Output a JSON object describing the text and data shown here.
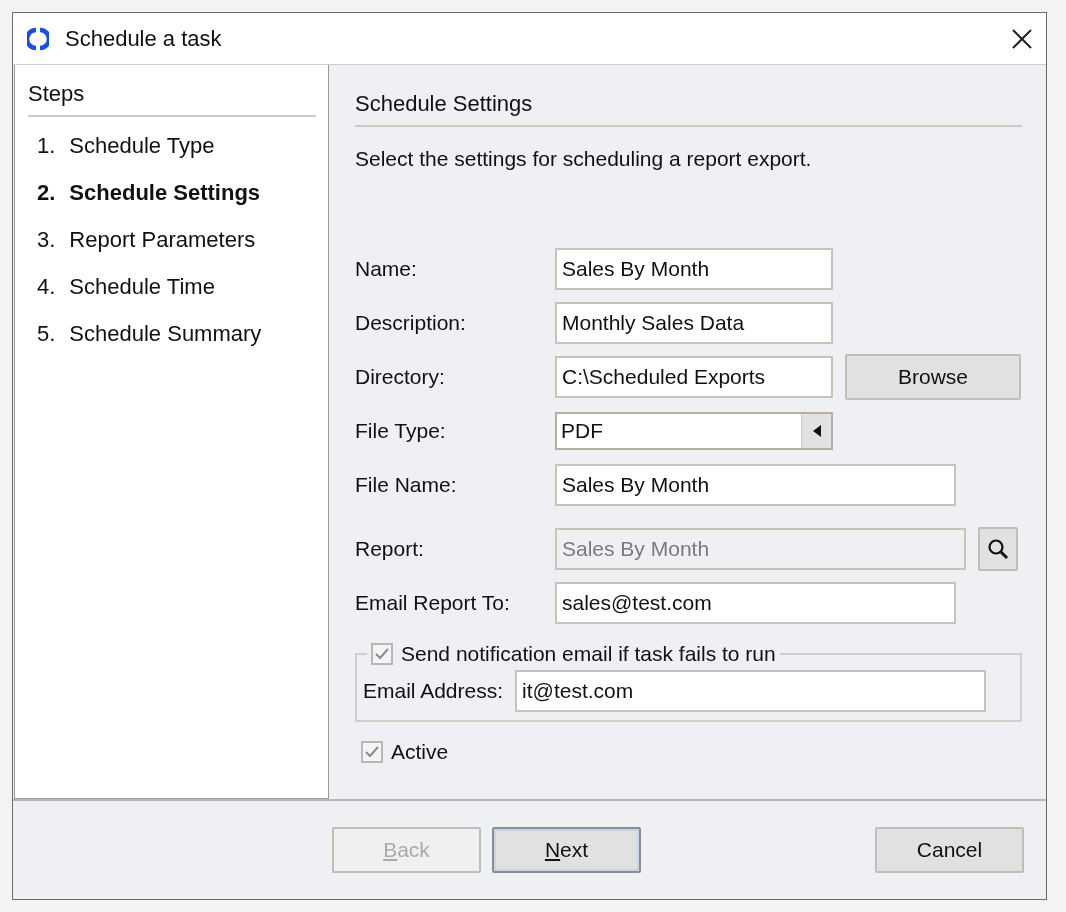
{
  "window": {
    "title": "Schedule a task"
  },
  "steps": {
    "heading": "Steps",
    "items": [
      {
        "number": "1.",
        "label": "Schedule Type",
        "selected": false
      },
      {
        "number": "2.",
        "label": "Schedule Settings",
        "selected": true
      },
      {
        "number": "3.",
        "label": "Report Parameters",
        "selected": false
      },
      {
        "number": "4.",
        "label": "Schedule Time",
        "selected": false
      },
      {
        "number": "5.",
        "label": "Schedule Summary",
        "selected": false
      }
    ]
  },
  "content": {
    "heading": "Schedule Settings",
    "description": "Select the settings for scheduling a report export.",
    "fields": [
      {
        "kind": "text",
        "label": "Name:",
        "value": "Sales By Month"
      },
      {
        "kind": "text",
        "label": "Description:",
        "value": "Monthly Sales Data"
      },
      {
        "kind": "path",
        "label": "Directory:",
        "value": "C:\\Scheduled Exports",
        "button": "Browse"
      },
      {
        "kind": "select",
        "label": "File Type:",
        "value": "PDF"
      },
      {
        "kind": "text",
        "label": "File Name:",
        "value": "Sales By Month"
      },
      {
        "kind": "lookup",
        "label": "Report:",
        "value": "Sales By Month",
        "disabled": true
      },
      {
        "kind": "text",
        "label": "Email Report To:",
        "value": "sales@test.com"
      }
    ],
    "notification": {
      "label": "Send notification email if task fails to run",
      "checked": true,
      "field": {
        "label": "Email Address:",
        "value": "it@test.com"
      }
    },
    "active": {
      "label": "Active",
      "checked": true
    }
  },
  "buttons": [
    {
      "mnemonic": "B",
      "label": "ack",
      "disabled": true,
      "default": false
    },
    {
      "mnemonic": "N",
      "label": "ext",
      "disabled": false,
      "default": true
    },
    {
      "label": "Cancel",
      "disabled": false,
      "default": false
    }
  ]
}
